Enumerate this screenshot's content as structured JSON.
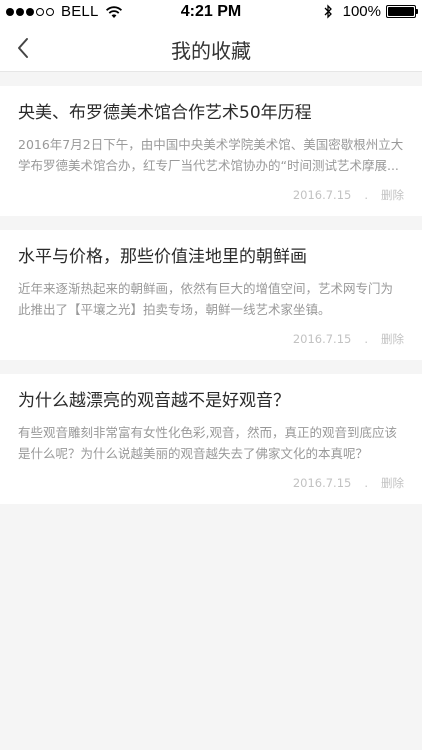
{
  "status_bar": {
    "carrier": "BELL",
    "time": "4:21 PM",
    "battery": "100%",
    "signal_bars_filled": 3,
    "signal_bars_total": 5
  },
  "nav": {
    "title": "我的收藏",
    "back_icon": "chevron-left-icon"
  },
  "favorites": [
    {
      "title": "央美、布罗德美术馆合作艺术50年历程",
      "desc": "2016年7月2日下午，由中国中央美术学院美术馆、美国密歇根州立大学布罗德美术馆合办，红专厂当代艺术馆协办的“时间测试艺术摩展...",
      "date": "2016.7.15",
      "sep": ".",
      "delete_label": "删除"
    },
    {
      "title": "水平与价格，那些价值洼地里的朝鲜画",
      "desc": "近年来逐渐热起来的朝鲜画，依然有巨大的增值空间，艺术网专门为此推出了【平壤之光】拍卖专场，朝鲜一线艺术家坐镇。",
      "date": "2016.7.15",
      "sep": ".",
      "delete_label": "删除"
    },
    {
      "title": "为什么越漂亮的观音越不是好观音？",
      "desc": "有些观音雕刻非常富有女性化色彩,观音，然而，真正的观音到底应该是什么呢？为什么说越美丽的观音越失去了佛家文化的本真呢？",
      "date": "2016.7.15",
      "sep": ".",
      "delete_label": "删除"
    }
  ]
}
